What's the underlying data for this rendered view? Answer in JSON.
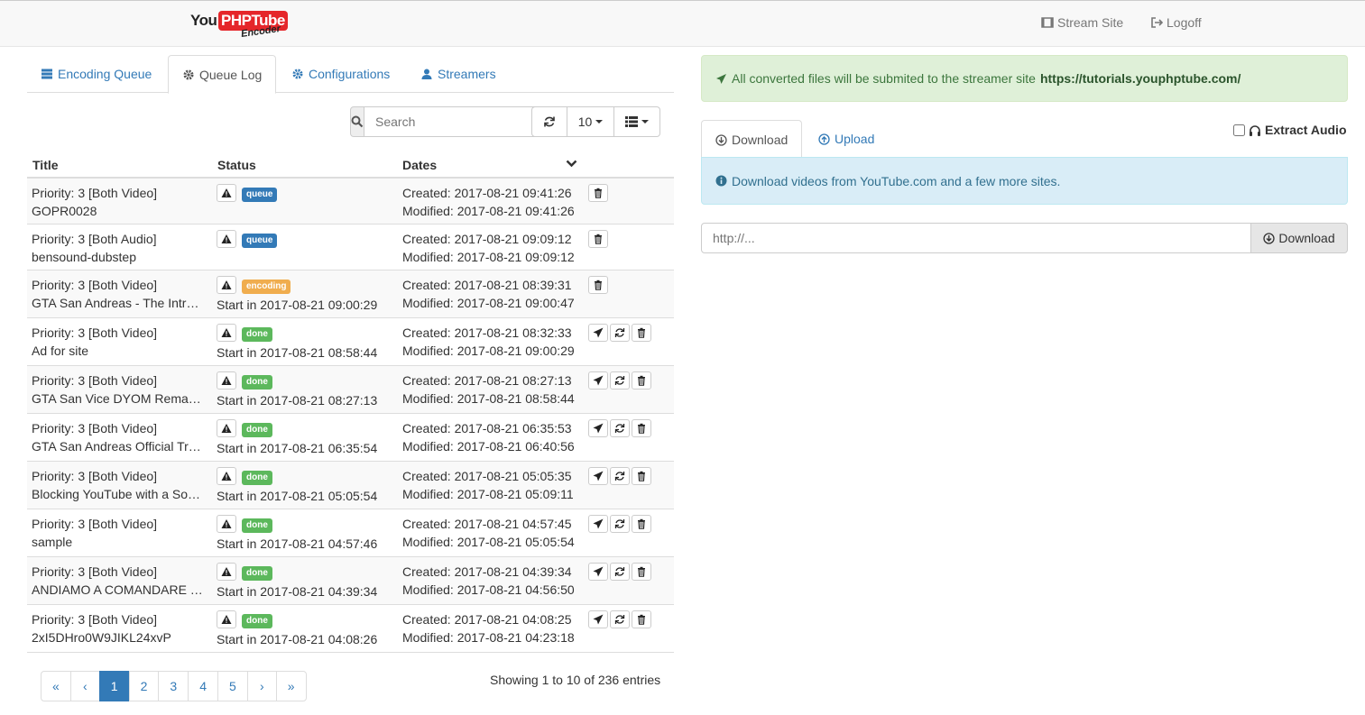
{
  "nav": {
    "logo": {
      "you": "You",
      "php": "PHPTube",
      "encoder": "Encoder"
    },
    "stream_site": "Stream Site",
    "logoff": "Logoff"
  },
  "tabs": [
    {
      "label": "Encoding Queue",
      "icon": "server-icon"
    },
    {
      "label": "Queue Log",
      "icon": "gear-icon"
    },
    {
      "label": "Configurations",
      "icon": "cog-icon"
    },
    {
      "label": "Streamers",
      "icon": "user-icon"
    }
  ],
  "toolbar": {
    "search_placeholder": "Search",
    "page_size": "10"
  },
  "table": {
    "headers": {
      "title": "Title",
      "status": "Status",
      "dates": "Dates"
    },
    "rows": [
      {
        "priority": "Priority: 3 [Both Video]",
        "name": "GOPR0028",
        "status": "queue",
        "start": "",
        "created": "Created: 2017-08-21 09:41:26",
        "modified": "Modified: 2017-08-21 09:41:26",
        "actions": "delete"
      },
      {
        "priority": "Priority: 3 [Both Audio]",
        "name": "bensound-dubstep",
        "status": "queue",
        "start": "",
        "created": "Created: 2017-08-21 09:09:12",
        "modified": "Modified: 2017-08-21 09:09:12",
        "actions": "delete"
      },
      {
        "priority": "Priority: 3 [Both Video]",
        "name": "GTA San Andreas - The Intr…",
        "status": "encoding",
        "start": "Start in 2017-08-21 09:00:29",
        "created": "Created: 2017-08-21 08:39:31",
        "modified": "Modified: 2017-08-21 09:00:47",
        "actions": "delete"
      },
      {
        "priority": "Priority: 3 [Both Video]",
        "name": "Ad for site",
        "status": "done",
        "start": "Start in 2017-08-21 08:58:44",
        "created": "Created: 2017-08-21 08:32:33",
        "modified": "Modified: 2017-08-21 09:00:29",
        "actions": "all"
      },
      {
        "priority": "Priority: 3 [Both Video]",
        "name": "GTA San Vice DYOM Rema…",
        "status": "done",
        "start": "Start in 2017-08-21 08:27:13",
        "created": "Created: 2017-08-21 08:27:13",
        "modified": "Modified: 2017-08-21 08:58:44",
        "actions": "all"
      },
      {
        "priority": "Priority: 3 [Both Video]",
        "name": "GTA San Andreas Official Tr…",
        "status": "done",
        "start": "Start in 2017-08-21 06:35:54",
        "created": "Created: 2017-08-21 06:35:53",
        "modified": "Modified: 2017-08-21 06:40:56",
        "actions": "all"
      },
      {
        "priority": "Priority: 3 [Both Video]",
        "name": "Blocking YouTube with a So…",
        "status": "done",
        "start": "Start in 2017-08-21 05:05:54",
        "created": "Created: 2017-08-21 05:05:35",
        "modified": "Modified: 2017-08-21 05:09:11",
        "actions": "all"
      },
      {
        "priority": "Priority: 3 [Both Video]",
        "name": "sample",
        "status": "done",
        "start": "Start in 2017-08-21 04:57:46",
        "created": "Created: 2017-08-21 04:57:45",
        "modified": "Modified: 2017-08-21 05:05:54",
        "actions": "all"
      },
      {
        "priority": "Priority: 3 [Both Video]",
        "name": "ANDIAMO A COMANDARE …",
        "status": "done",
        "start": "Start in 2017-08-21 04:39:34",
        "created": "Created: 2017-08-21 04:39:34",
        "modified": "Modified: 2017-08-21 04:56:50",
        "actions": "all"
      },
      {
        "priority": "Priority: 3 [Both Video]",
        "name": "2xI5DHro0W9JIKL24xvP",
        "status": "done",
        "start": "Start in 2017-08-21 04:08:26",
        "created": "Created: 2017-08-21 04:08:25",
        "modified": "Modified: 2017-08-21 04:23:18",
        "actions": "all"
      }
    ]
  },
  "pagination": {
    "items": [
      "«",
      "‹",
      "1",
      "2",
      "3",
      "4",
      "5",
      "›",
      "»"
    ],
    "active": "1",
    "showing": "Showing 1 to 10 of 236 entries"
  },
  "right": {
    "success_text": "All converted files will be submited to the streamer site",
    "success_url": "https://tutorials.youphptube.com/",
    "tab_download": "Download",
    "tab_upload": "Upload",
    "extract_audio": "Extract Audio",
    "info_text": "Download videos from YouTube.com and a few more sites.",
    "url_placeholder": "http://...",
    "download_button": "Download"
  },
  "colors": {
    "queue": "#337ab7",
    "encoding": "#f0ad4e",
    "done": "#5cb85c",
    "link": "#337ab7"
  }
}
